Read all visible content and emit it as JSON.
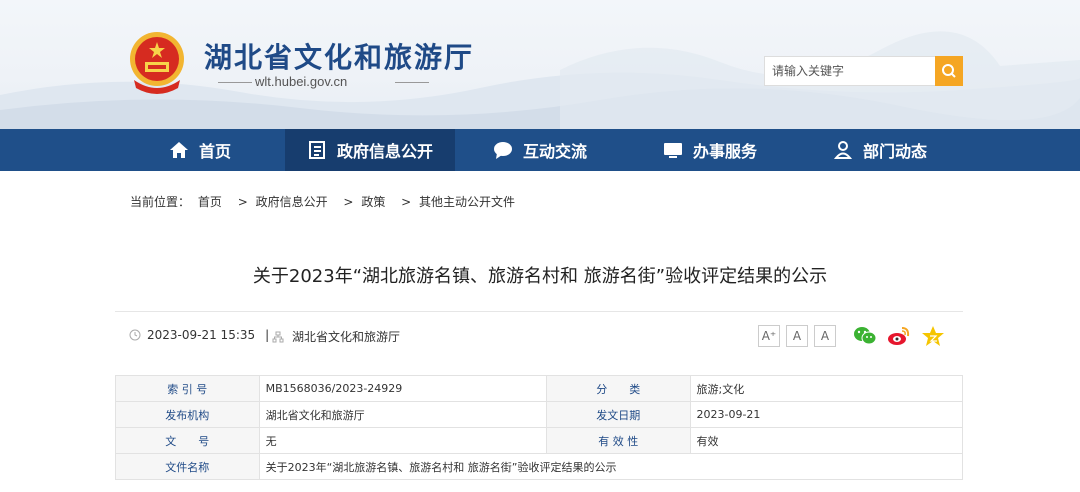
{
  "header": {
    "site_title": "湖北省文化和旅游厅",
    "domain": "wlt.hubei.gov.cn",
    "search_placeholder": "请输入关键字"
  },
  "nav": [
    {
      "label": "首页",
      "icon": "home-icon"
    },
    {
      "label": "政府信息公开",
      "icon": "document-icon"
    },
    {
      "label": "互动交流",
      "icon": "chat-bubble-icon"
    },
    {
      "label": "办事服务",
      "icon": "monitor-icon"
    },
    {
      "label": "部门动态",
      "icon": "person-icon"
    }
  ],
  "breadcrumb": {
    "prefix": "当前位置：",
    "items": [
      "首页",
      "政府信息公开",
      "政策",
      "其他主动公开文件"
    ],
    "separator": ">"
  },
  "article": {
    "title": "关于2023年“湖北旅游名镇、旅游名村和 旅游名街”验收评定结果的公示",
    "date": "2023-09-21 15:35",
    "divider": "|",
    "source": "湖北省文化和旅游厅",
    "font_buttons": [
      "A⁺",
      "A",
      "A"
    ]
  },
  "info_table": [
    {
      "k1": "索 引 号",
      "v1": "MB1568036/2023-24929",
      "k2": "分　　类",
      "v2": "旅游;文化"
    },
    {
      "k1": "发布机构",
      "v1": "湖北省文化和旅游厅",
      "k2": "发文日期",
      "v2": "2023-09-21"
    },
    {
      "k1": "文　　号",
      "v1": "无",
      "k2": "有 效 性",
      "v2": "有效"
    },
    {
      "k1": "文件名称",
      "v1": "关于2023年“湖北旅游名镇、旅游名村和 旅游名街”验收评定结果的公示"
    }
  ],
  "colors": {
    "nav_bg": "#1f4f89",
    "nav_active": "#173d6e",
    "accent_orange": "#f5a623",
    "title_blue": "#1f4a87"
  }
}
